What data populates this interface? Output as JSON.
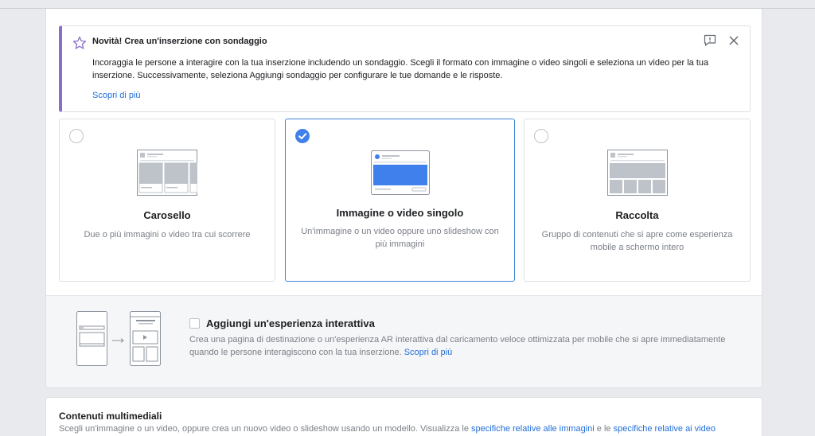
{
  "notice": {
    "title": "Novità! Crea un'inserzione con sondaggio",
    "body": "Incoraggia le persone a interagire con la tua inserzione includendo un sondaggio. Scegli il formato con immagine o video singoli e seleziona un video per la tua inserzione. Successivamente, seleziona Aggiungi sondaggio per configurare le tue domande e le risposte.",
    "link": "Scopri di più",
    "icons": [
      "star-icon",
      "feedback-icon",
      "close-icon"
    ]
  },
  "formats": [
    {
      "label": "Carosello",
      "desc": "Due o più immagini o video tra cui scorrere",
      "selected": false
    },
    {
      "label": "Immagine o video singolo",
      "desc": "Un'immagine o un video oppure uno slideshow con più immagini",
      "selected": true
    },
    {
      "label": "Raccolta",
      "desc": "Gruppo di contenuti che si apre come esperienza mobile a schermo intero",
      "selected": false
    }
  ],
  "interactive": {
    "heading": "Aggiungi un'esperienza interattiva",
    "text": "Crea una pagina di destinazione o un'esperienza AR interattiva dal caricamento veloce ottimizzata per mobile che si apre immediatamente quando le persone interagiscono con la tua inserzione.",
    "link": "Scopri di più",
    "checked": false
  },
  "media": {
    "heading": "Contenuti multimediali",
    "text_before": "Scegli un'immagine o un video, oppure crea un nuovo video o slideshow usando un modello. Visualizza le",
    "link1": "specifiche relative alle immagini",
    "text_middle": "e le",
    "link2": "specifiche relative ai video"
  },
  "colors": {
    "accent": "#4080ec",
    "link": "#216fdb",
    "notice_bar": "#8c6cc8"
  }
}
